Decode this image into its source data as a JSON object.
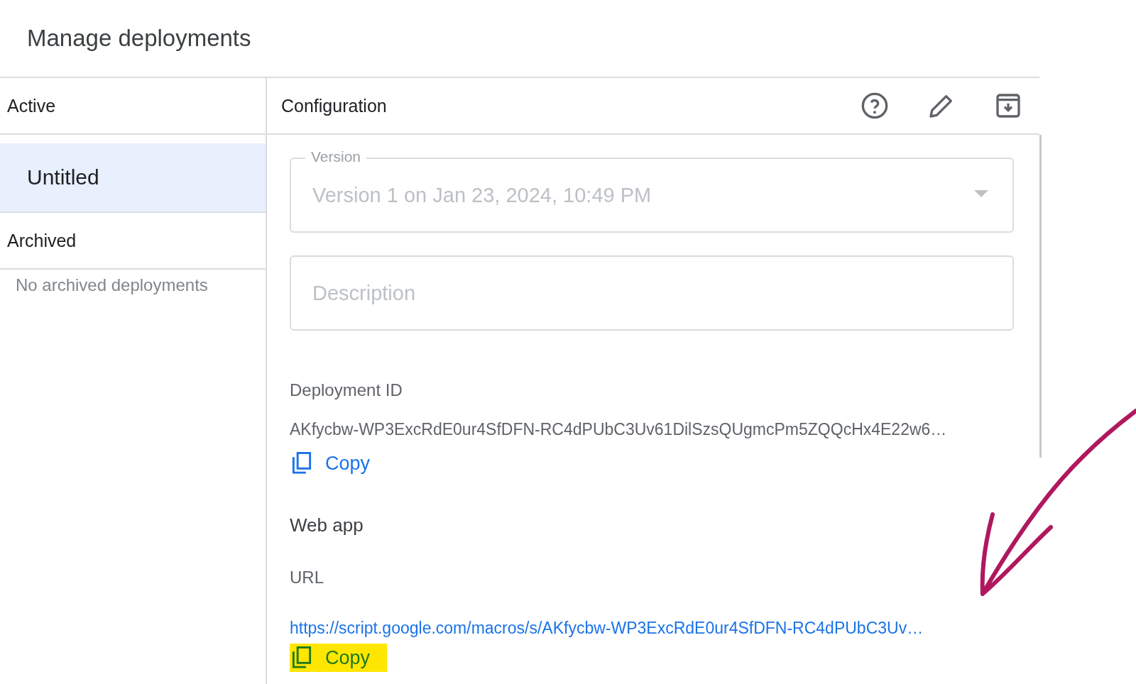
{
  "dialog": {
    "title": "Manage deployments"
  },
  "sidebar": {
    "sections": [
      {
        "heading": "Active",
        "items": [
          {
            "label": "Untitled",
            "selected": true
          }
        ]
      },
      {
        "heading": "Archived",
        "empty_text": "No archived deployments"
      }
    ]
  },
  "panel": {
    "heading": "Configuration",
    "actions": [
      {
        "kind": "help"
      },
      {
        "kind": "edit"
      },
      {
        "kind": "archive"
      }
    ],
    "version": {
      "label": "Version",
      "value": "Version 1 on Jan 23, 2024, 10:49 PM",
      "disabled": true
    },
    "description": {
      "placeholder": "Description"
    },
    "deployment_id": {
      "label": "Deployment ID",
      "value": "AKfycbw-WP3ExcRdE0ur4SfDFN-RC4dPUbC3Uv61DilSzsQUgmcPm5ZQQcHx4E22w6…",
      "copy": {
        "label": "Copy",
        "highlighted": false
      }
    },
    "web_app": {
      "heading": "Web app",
      "url_label": "URL",
      "url": "https://script.google.com/macros/s/AKfycbw-WP3ExcRdE0ur4SfDFN-RC4dPUbC3Uv…",
      "copy": {
        "label": "Copy",
        "highlighted": true
      }
    }
  }
}
